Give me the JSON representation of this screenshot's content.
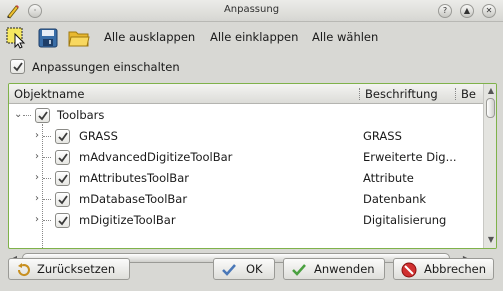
{
  "window": {
    "title": "Anpassung"
  },
  "toolbar": {
    "expand_all": "Alle ausklappen",
    "collapse_all": "Alle einklappen",
    "select_all": "Alle wählen"
  },
  "enable_checkbox": {
    "label": "Anpassungen einschalten",
    "checked": true
  },
  "tree": {
    "columns": [
      "Objektname",
      "Beschriftung",
      "Be"
    ],
    "root": {
      "name": "Toolbars",
      "checked": true,
      "expanded": true
    },
    "rows": [
      {
        "name": "GRASS",
        "caption": "GRASS",
        "checked": true
      },
      {
        "name": "mAdvancedDigitizeToolBar",
        "caption": "Erweiterte Dig...",
        "checked": true
      },
      {
        "name": "mAttributesToolBar",
        "caption": "Attribute",
        "checked": true
      },
      {
        "name": "mDatabaseToolBar",
        "caption": "Datenbank",
        "checked": true
      },
      {
        "name": "mDigitizeToolBar",
        "caption": "Digitalisierung",
        "checked": true
      }
    ]
  },
  "buttons": {
    "reset": "Zurücksetzen",
    "ok": "OK",
    "apply": "Anwenden",
    "cancel": "Abbrechen"
  },
  "icons": {
    "app": "qgis-pencil-icon",
    "select_widget": "select-widget-icon",
    "save": "save-icon",
    "open": "folder-open-icon"
  },
  "colors": {
    "accent": "#7fb24a",
    "check": "#3a3a3a"
  }
}
